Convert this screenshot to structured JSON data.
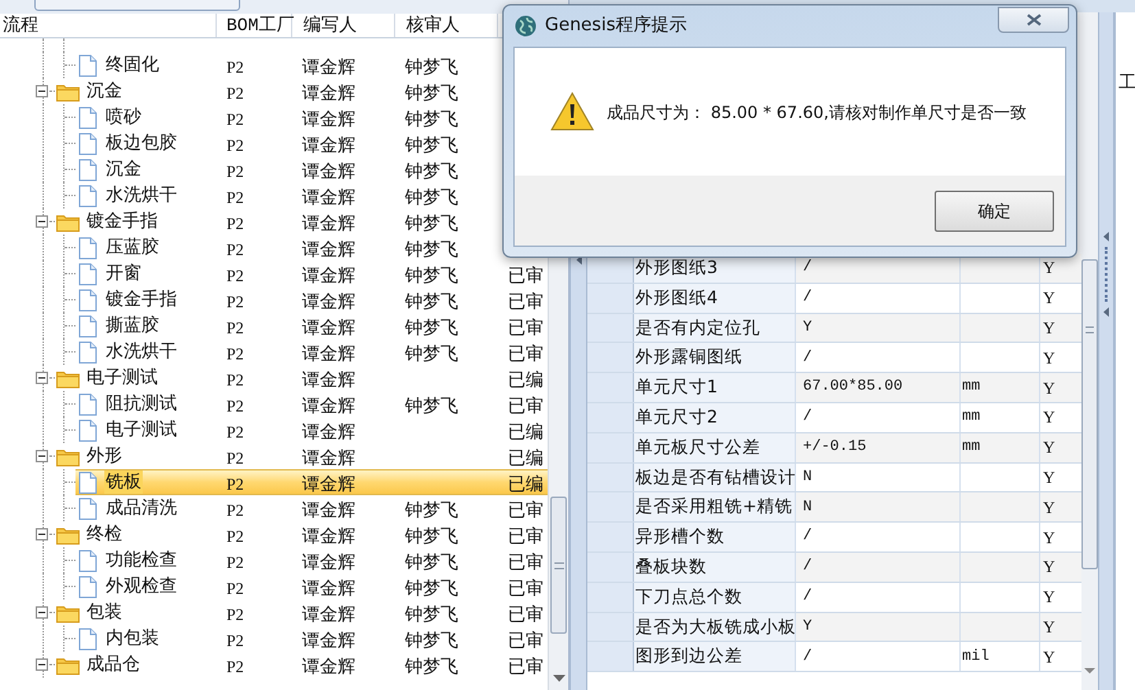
{
  "process_tree": {
    "columns": [
      "流程",
      "BOM工厂",
      "编写人",
      "核审人"
    ],
    "items": [
      {
        "kind": "file",
        "label": "终固化",
        "bom": "P2",
        "writer": "谭金辉",
        "reviewer": "钟梦飞",
        "selected": false
      },
      {
        "kind": "folder",
        "label": "沉金",
        "bom": "P2",
        "writer": "谭金辉",
        "reviewer": "钟梦飞",
        "expanded": true,
        "selected": false,
        "children": [
          {
            "kind": "file",
            "label": "喷砂",
            "bom": "P2",
            "writer": "谭金辉",
            "reviewer": "钟梦飞",
            "selected": false
          },
          {
            "kind": "file",
            "label": "板边包胶",
            "bom": "P2",
            "writer": "谭金辉",
            "reviewer": "钟梦飞",
            "selected": false
          },
          {
            "kind": "file",
            "label": "沉金",
            "bom": "P2",
            "writer": "谭金辉",
            "reviewer": "钟梦飞",
            "selected": false
          },
          {
            "kind": "file",
            "label": "水洗烘干",
            "bom": "P2",
            "writer": "谭金辉",
            "reviewer": "钟梦飞",
            "selected": false
          }
        ]
      },
      {
        "kind": "folder",
        "label": "镀金手指",
        "bom": "P2",
        "writer": "谭金辉",
        "reviewer": "钟梦飞",
        "expanded": true,
        "selected": false,
        "children": [
          {
            "kind": "file",
            "label": "压蓝胶",
            "bom": "P2",
            "writer": "谭金辉",
            "reviewer": "钟梦飞",
            "selected": false
          },
          {
            "kind": "file",
            "label": "开窗",
            "bom": "P2",
            "writer": "谭金辉",
            "reviewer": "钟梦飞",
            "status": "已审",
            "selected": false
          },
          {
            "kind": "file",
            "label": "镀金手指",
            "bom": "P2",
            "writer": "谭金辉",
            "reviewer": "钟梦飞",
            "status": "已审",
            "selected": false
          },
          {
            "kind": "file",
            "label": "撕蓝胶",
            "bom": "P2",
            "writer": "谭金辉",
            "reviewer": "钟梦飞",
            "status": "已审",
            "selected": false
          },
          {
            "kind": "file",
            "label": "水洗烘干",
            "bom": "P2",
            "writer": "谭金辉",
            "reviewer": "钟梦飞",
            "status": "已审",
            "selected": false
          }
        ]
      },
      {
        "kind": "folder",
        "label": "电子测试",
        "bom": "P2",
        "writer": "谭金辉",
        "status": "已编",
        "expanded": true,
        "selected": false,
        "children": [
          {
            "kind": "file",
            "label": "阻抗测试",
            "bom": "P2",
            "writer": "谭金辉",
            "reviewer": "钟梦飞",
            "status": "已审",
            "selected": false
          },
          {
            "kind": "file",
            "label": "电子测试",
            "bom": "P2",
            "writer": "谭金辉",
            "status": "已编",
            "selected": false
          }
        ]
      },
      {
        "kind": "folder",
        "label": "外形",
        "bom": "P2",
        "writer": "谭金辉",
        "status": "已编",
        "expanded": true,
        "selected": false,
        "children": [
          {
            "kind": "file",
            "label": "铣板",
            "bom": "P2",
            "writer": "谭金辉",
            "status": "已编",
            "selected": true
          },
          {
            "kind": "file",
            "label": "成品清洗",
            "bom": "P2",
            "writer": "谭金辉",
            "reviewer": "钟梦飞",
            "status": "已审",
            "selected": false
          }
        ]
      },
      {
        "kind": "folder",
        "label": "终检",
        "bom": "P2",
        "writer": "谭金辉",
        "reviewer": "钟梦飞",
        "status": "已审",
        "expanded": true,
        "selected": false,
        "children": [
          {
            "kind": "file",
            "label": "功能检查",
            "bom": "P2",
            "writer": "谭金辉",
            "reviewer": "钟梦飞",
            "status": "已审",
            "selected": false
          },
          {
            "kind": "file",
            "label": "外观检查",
            "bom": "P2",
            "writer": "谭金辉",
            "reviewer": "钟梦飞",
            "status": "已审",
            "selected": false
          }
        ]
      },
      {
        "kind": "folder",
        "label": "包装",
        "bom": "P2",
        "writer": "谭金辉",
        "reviewer": "钟梦飞",
        "status": "已审",
        "expanded": true,
        "selected": false,
        "children": [
          {
            "kind": "file",
            "label": "内包装",
            "bom": "P2",
            "writer": "谭金辉",
            "reviewer": "钟梦飞",
            "status": "已审",
            "selected": false
          }
        ]
      },
      {
        "kind": "folder",
        "label": "成品仓",
        "bom": "P2",
        "writer": "谭金辉",
        "reviewer": "钟梦飞",
        "status": "已审",
        "expanded": true,
        "selected": false
      }
    ]
  },
  "side_panel": {
    "label": "工"
  },
  "parameter_grid": {
    "rows": [
      {
        "name": "外形图纸3",
        "value": "/",
        "check": "Y"
      },
      {
        "name": "外形图纸4",
        "value": "/",
        "check": "Y"
      },
      {
        "name": "是否有内定位孔",
        "value": "Y",
        "check": "Y"
      },
      {
        "name": "外形露铜图纸",
        "value": "/",
        "check": "Y"
      },
      {
        "name": "单元尺寸1",
        "value": "67.00*85.00",
        "unit": "mm",
        "check": "Y"
      },
      {
        "name": "单元尺寸2",
        "value": "/",
        "unit": "mm",
        "check": "Y"
      },
      {
        "name": "单元板尺寸公差",
        "value": "+/-0.15",
        "unit": "mm",
        "check": "Y"
      },
      {
        "name": "板边是否有钻槽设计",
        "value": "N",
        "check": "Y"
      },
      {
        "name": "是否采用粗铣+精铣",
        "value": "N",
        "check": "Y"
      },
      {
        "name": "异形槽个数",
        "value": "/",
        "check": "Y"
      },
      {
        "name": "叠板块数",
        "value": "/",
        "check": "Y"
      },
      {
        "name": "下刀点总个数",
        "value": "/",
        "check": "Y"
      },
      {
        "name": "是否为大板铣成小板",
        "value": "Y",
        "check": "Y"
      },
      {
        "name": "图形到边公差",
        "value": "/",
        "unit": "mil",
        "check": "Y"
      }
    ]
  },
  "dialog": {
    "title": "Genesis程序提示",
    "message": "成品尺寸为： 85.00 * 67.60,请核对制作单尺寸是否一致",
    "button": "确定"
  }
}
